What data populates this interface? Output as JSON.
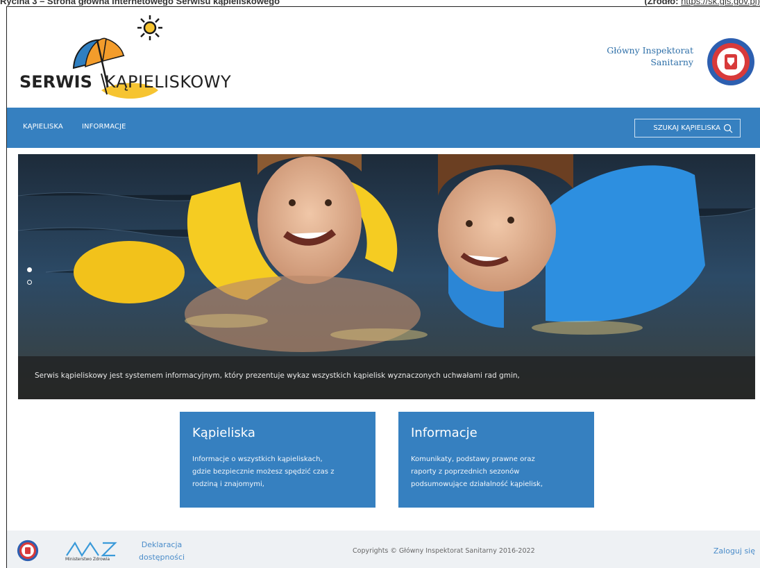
{
  "document_caption": {
    "left": "Rycina 3 – Strona główna internetowego Serwisu kąpieliskowego",
    "right_prefix": "(Źródło:",
    "right_link": "https://sk.gis.gov.pl)"
  },
  "header": {
    "logo_bold": "SERWIS",
    "logo_light": "KĄPIELISKOWY",
    "institution_line1": "Główny Inspektorat",
    "institution_line2": "Sanitarny"
  },
  "nav": {
    "items": [
      {
        "label": "KĄPIELISKA"
      },
      {
        "label": "INFORMACJE"
      }
    ],
    "search_label": "SZUKAJ KĄPIELISKA"
  },
  "hero": {
    "caption": "Serwis kąpieliskowy jest systemem informacyjnym, który prezentuje wykaz wszystkich kąpielisk wyznaczonych uchwałami rad gmin,",
    "active_slide": 1,
    "slide_count": 2
  },
  "cards": [
    {
      "title": "Kąpieliska",
      "lines": [
        "Informacje o wszystkich kąpieliskach,",
        "gdzie bezpiecznie możesz spędzić czas z",
        "rodziną i znajomymi,"
      ]
    },
    {
      "title": "Informacje",
      "lines": [
        "Komunikaty, podstawy prawne oraz",
        "raporty z poprzednich sezonów",
        "podsumowujące działalność kąpielisk,"
      ]
    }
  ],
  "footer": {
    "ministry_caption": "Ministerstwo Zdrowia",
    "declaration_line1": "Deklaracja",
    "declaration_line2": "dostępności",
    "copyright": "Copyrights © Główny Inspektorat Sanitarny 2016-2022",
    "login": "Zaloguj się"
  },
  "colors": {
    "primary_blue": "#3680c0",
    "link_blue": "#4a8cc9",
    "footer_bg": "#eef1f4"
  }
}
